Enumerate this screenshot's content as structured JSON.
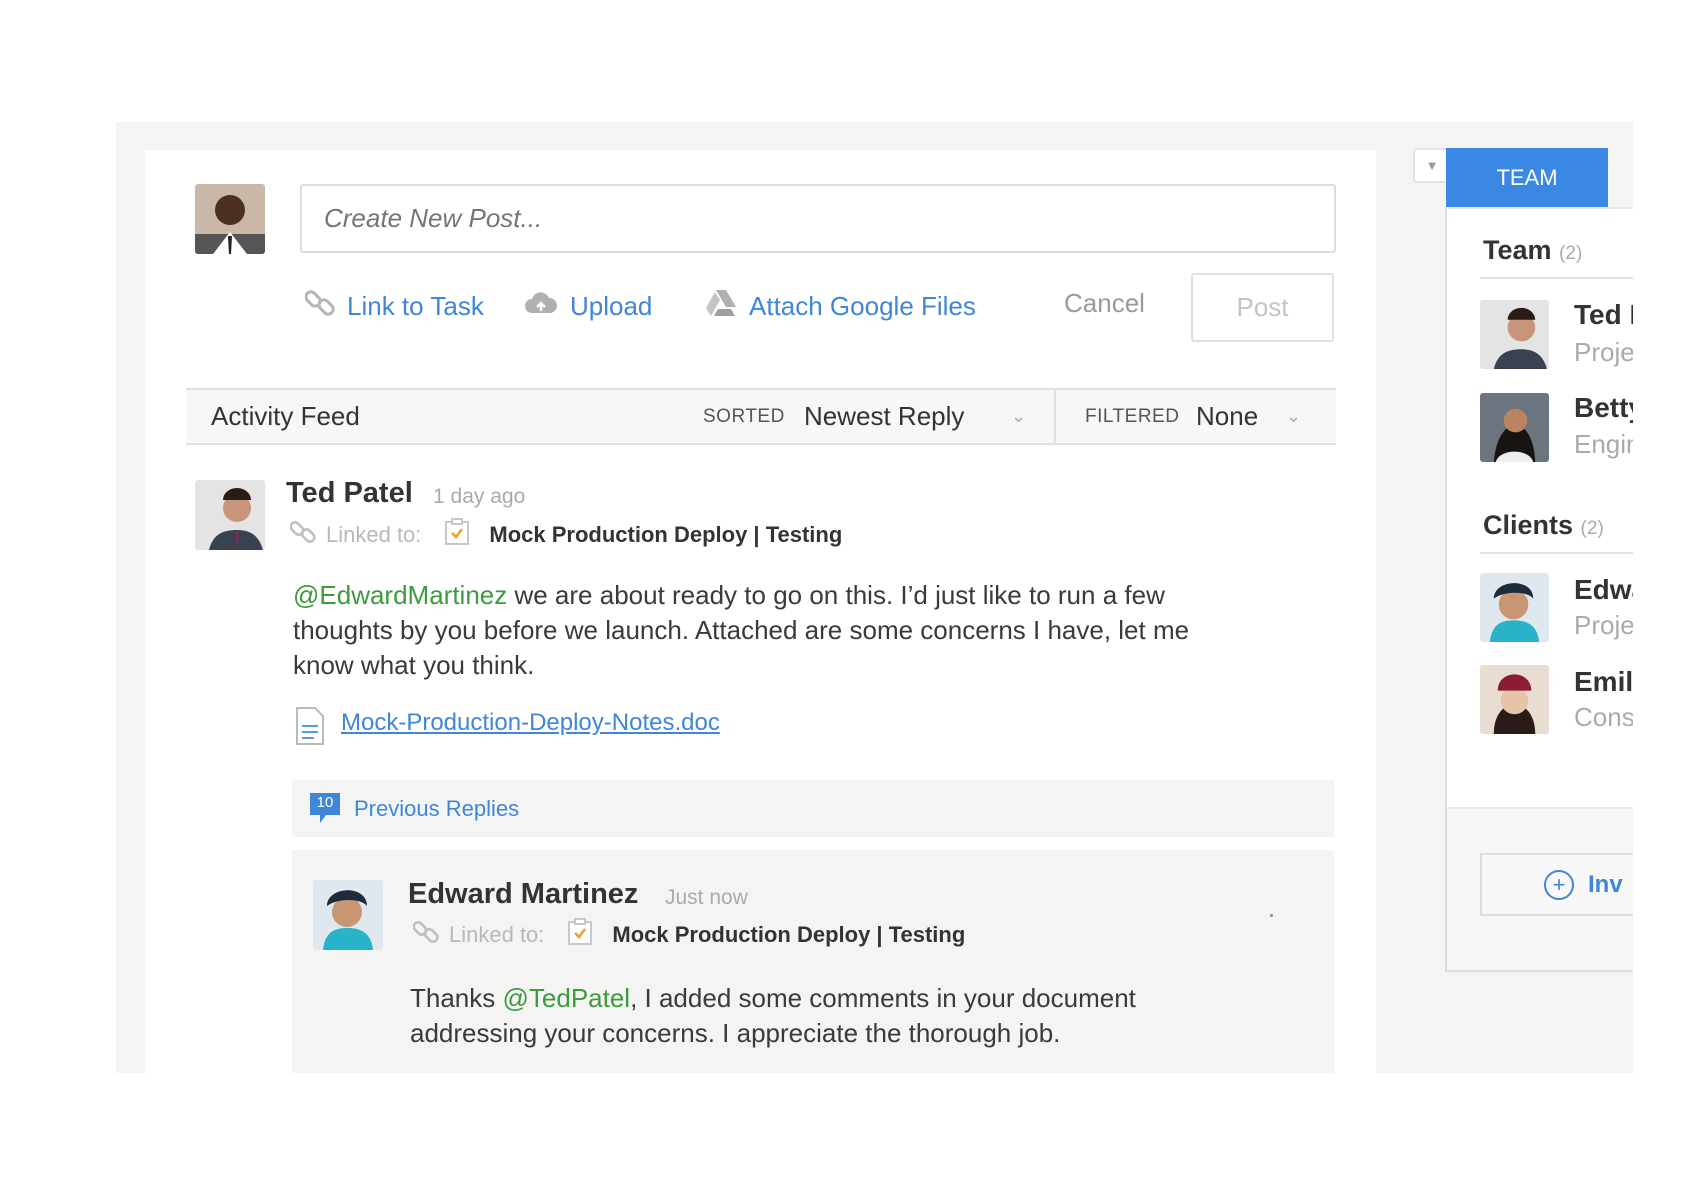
{
  "composer": {
    "placeholder": "Create New Post...",
    "link_to_task": "Link to Task",
    "upload": "Upload",
    "attach_google": "Attach Google Files",
    "cancel": "Cancel",
    "post": "Post"
  },
  "feed_bar": {
    "title": "Activity Feed",
    "sorted_label": "SORTED",
    "sorted_value": "Newest Reply",
    "filtered_label": "FILTERED",
    "filtered_value": "None"
  },
  "post": {
    "author": "Ted Patel",
    "time": "1 day ago",
    "linked_label": "Linked to:",
    "linked_task": "Mock Production Deploy | Testing",
    "mention": "@EdwardMartinez",
    "body_line1": " we are about ready to go on this. I’d just like to run a few",
    "body_line2": "thoughts by you before we launch. Attached are some concerns I have, let me",
    "body_line3": "know what you think.",
    "attachment": "Mock-Production-Deploy-Notes.doc"
  },
  "previous_replies": {
    "count": "10",
    "label": "Previous Replies"
  },
  "reply": {
    "author": "Edward Martinez",
    "time": "Just now",
    "linked_label": "Linked to:",
    "linked_task": "Mock Production Deploy | Testing",
    "prefix": "Thanks ",
    "mention": "@TedPatel",
    "body_line1": ", I added some comments in your document",
    "body_line2": "addressing your concerns. I appreciate the thorough job."
  },
  "sidebar": {
    "tab": "TEAM",
    "team_title": "Team",
    "team_count": "(2)",
    "team": [
      {
        "name": "Ted P",
        "role": "Projec"
      },
      {
        "name": "Betty",
        "role": "Engin"
      }
    ],
    "clients_title": "Clients",
    "clients_count": "(2)",
    "clients": [
      {
        "name": "Edwa",
        "role": "Projec"
      },
      {
        "name": "Emily",
        "role": "Consu"
      }
    ],
    "invite": "Inv"
  },
  "colors": {
    "accent": "#3b87e4",
    "link": "#3f86d9",
    "mention": "#3d9a3d",
    "task_check": "#f0a020"
  }
}
